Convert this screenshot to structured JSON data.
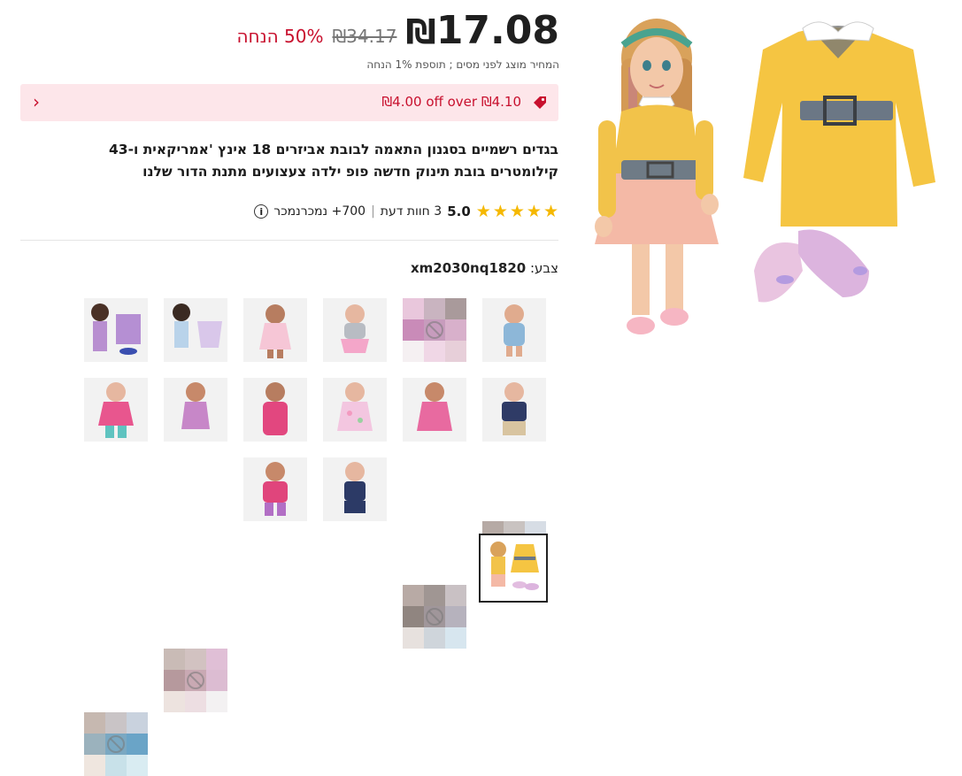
{
  "price": {
    "current": "17.08",
    "currency_symbol": "₪",
    "old": "₪34.17",
    "discount": "50% הנחה",
    "tax_note": "המחיר מוצג לפני מסים ; תוספת 1% הנחה"
  },
  "coupon": {
    "text": "₪4.00 off over ₪4.10",
    "icon": "tag-icon",
    "chevron": "›"
  },
  "product": {
    "title": "בגדים רשמיים בסגנון התאמה לבובת אביזרים 18 אינץ 'אמריקאית ו-43 קילומטרים בובת תינוק חדשה פופ ילדה צעצועים מתנת הדור שלנו"
  },
  "rating": {
    "score": "5.0",
    "reviews": "3 חוות דעת",
    "separator": "|",
    "sold": "700+ נמכרנמכר",
    "info": "i",
    "star_char": "★",
    "star_count": 5
  },
  "color": {
    "label": "צבע:",
    "value": "xm2030nq1820"
  },
  "colors": {
    "star": "#f5b800",
    "accent_red": "#c8102e",
    "coupon_bg": "#fde6ea"
  }
}
